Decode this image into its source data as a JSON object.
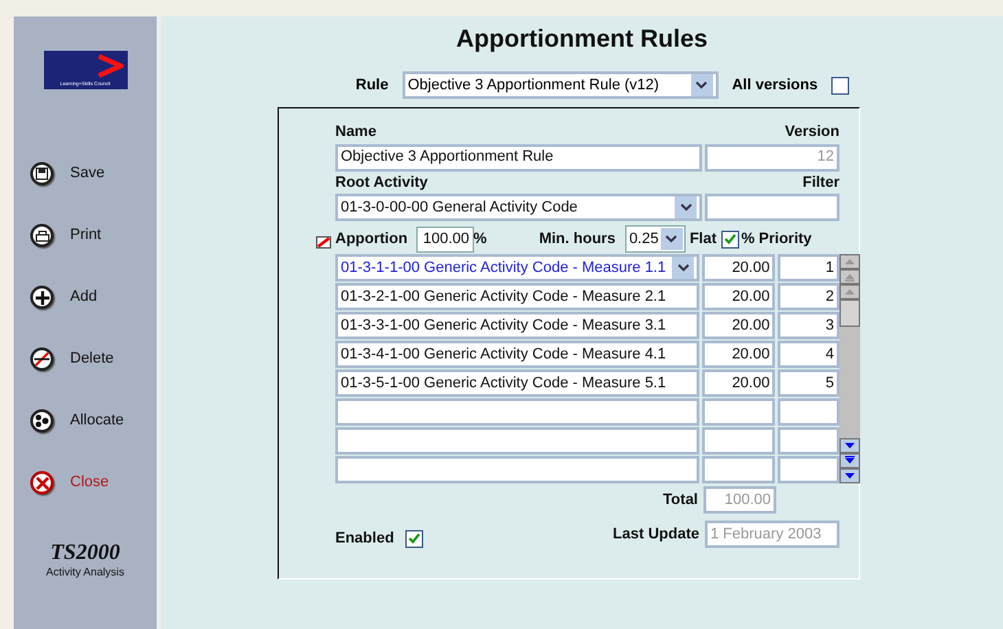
{
  "sidebar": {
    "logo": "Learning+Skills Council",
    "items": [
      {
        "kind": "save",
        "label": "Save"
      },
      {
        "kind": "print",
        "label": "Print"
      },
      {
        "kind": "add",
        "label": "Add"
      },
      {
        "kind": "delete",
        "label": "Delete"
      },
      {
        "kind": "allocate",
        "label": "Allocate"
      },
      {
        "kind": "close",
        "label": "Close"
      }
    ],
    "product": "TS2000",
    "product_subtitle": "Activity Analysis"
  },
  "title": "Apportionment Rules",
  "rule": {
    "label": "Rule",
    "value": "Objective 3 Apportionment Rule (v12)",
    "all_versions_label": "All versions",
    "all_versions": false
  },
  "form": {
    "name_label": "Name",
    "name": "Objective 3 Apportionment Rule",
    "version_label": "Version",
    "version": "12",
    "root_label": "Root Activity",
    "root": "01-3-0-00-00 General Activity Code",
    "filter_label": "Filter",
    "apportion_label": "Apportion",
    "apportion": "100.00",
    "percent_sign": "%",
    "min_hours_label": "Min. hours",
    "min_hours": "0.25",
    "flat_label": "Flat",
    "flat_checked": true,
    "percent_label": "%",
    "priority_label": "Priority",
    "rows": [
      {
        "activity": "01-3-1-1-00 Generic Activity Code - Measure 1.1",
        "flat": "20.00",
        "priority": "1",
        "selected": true
      },
      {
        "activity": "01-3-2-1-00 Generic Activity Code - Measure 2.1",
        "flat": "20.00",
        "priority": "2",
        "selected": false
      },
      {
        "activity": "01-3-3-1-00 Generic Activity Code - Measure 3.1",
        "flat": "20.00",
        "priority": "3",
        "selected": false
      },
      {
        "activity": "01-3-4-1-00 Generic Activity Code - Measure 4.1",
        "flat": "20.00",
        "priority": "4",
        "selected": false
      },
      {
        "activity": "01-3-5-1-00 Generic Activity Code - Measure 5.1",
        "flat": "20.00",
        "priority": "5",
        "selected": false
      },
      {
        "selected": false
      },
      {
        "selected": false
      },
      {
        "selected": false
      }
    ],
    "total_label": "Total",
    "total": "100.00",
    "enabled_label": "Enabled",
    "enabled": true,
    "last_update_label": "Last Update",
    "last_update": "1 February 2003"
  }
}
